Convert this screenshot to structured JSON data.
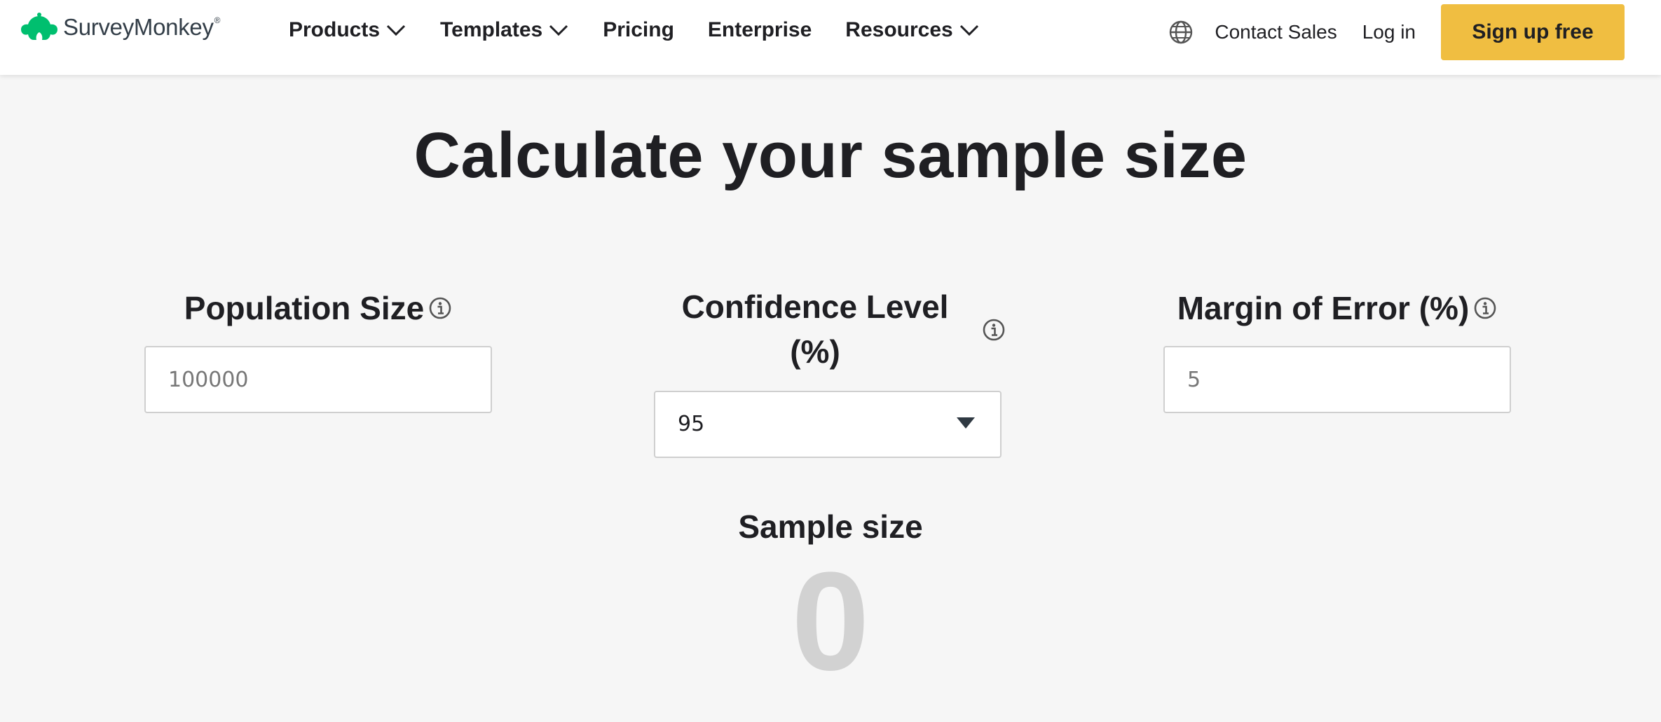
{
  "header": {
    "brand_name": "SurveyMonkey",
    "brand_mark": "®",
    "brand_color": "#00bf6f",
    "nav": [
      {
        "label": "Products",
        "has_dropdown": true
      },
      {
        "label": "Templates",
        "has_dropdown": true
      },
      {
        "label": "Pricing",
        "has_dropdown": false
      },
      {
        "label": "Enterprise",
        "has_dropdown": false
      },
      {
        "label": "Resources",
        "has_dropdown": true
      }
    ],
    "language_icon": "globe-icon",
    "contact_sales": "Contact Sales",
    "log_in": "Log in",
    "sign_up": "Sign up free",
    "sign_up_color": "#f0be41"
  },
  "main": {
    "title": "Calculate your sample size",
    "population": {
      "label": "Population Size",
      "placeholder": "100000",
      "value": ""
    },
    "confidence": {
      "label": "Confidence Level (%)",
      "selected": "95"
    },
    "margin": {
      "label": "Margin of Error (%)",
      "placeholder": "5",
      "value": ""
    },
    "result": {
      "label": "Sample size",
      "value": "0"
    }
  }
}
